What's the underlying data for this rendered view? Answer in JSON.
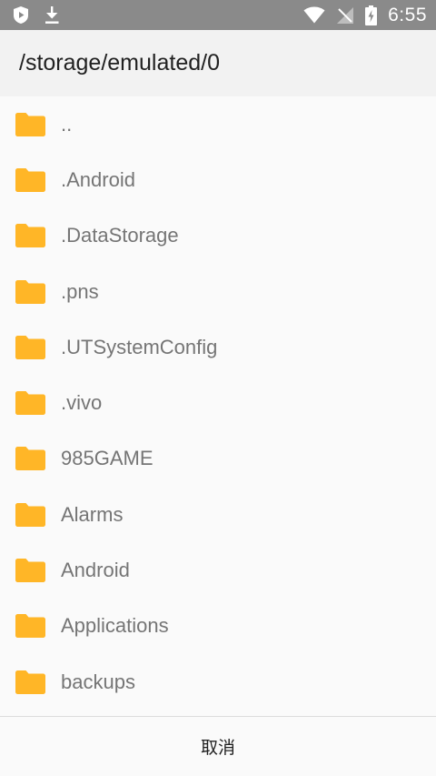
{
  "status_bar": {
    "time": "6:55",
    "left_icons": [
      "shield-app-icon",
      "download-icon"
    ],
    "right_icons": [
      "wifi-icon",
      "no-signal-icon",
      "battery-charging-icon"
    ],
    "background": "#8a8a8a"
  },
  "header": {
    "path": "/storage/emulated/0"
  },
  "file_list": {
    "items": [
      {
        "name": "..",
        "icon": "folder-icon"
      },
      {
        "name": ".Android",
        "icon": "folder-icon"
      },
      {
        "name": ".DataStorage",
        "icon": "folder-icon"
      },
      {
        "name": ".pns",
        "icon": "folder-icon"
      },
      {
        "name": ".UTSystemConfig",
        "icon": "folder-icon"
      },
      {
        "name": ".vivo",
        "icon": "folder-icon"
      },
      {
        "name": "985GAME",
        "icon": "folder-icon"
      },
      {
        "name": "Alarms",
        "icon": "folder-icon"
      },
      {
        "name": "Android",
        "icon": "folder-icon"
      },
      {
        "name": "Applications",
        "icon": "folder-icon"
      },
      {
        "name": "backups",
        "icon": "folder-icon"
      }
    ]
  },
  "footer": {
    "cancel_label": "取消"
  },
  "colors": {
    "folder": "#ffb627",
    "text_secondary": "#757575",
    "text_primary": "#212121"
  }
}
